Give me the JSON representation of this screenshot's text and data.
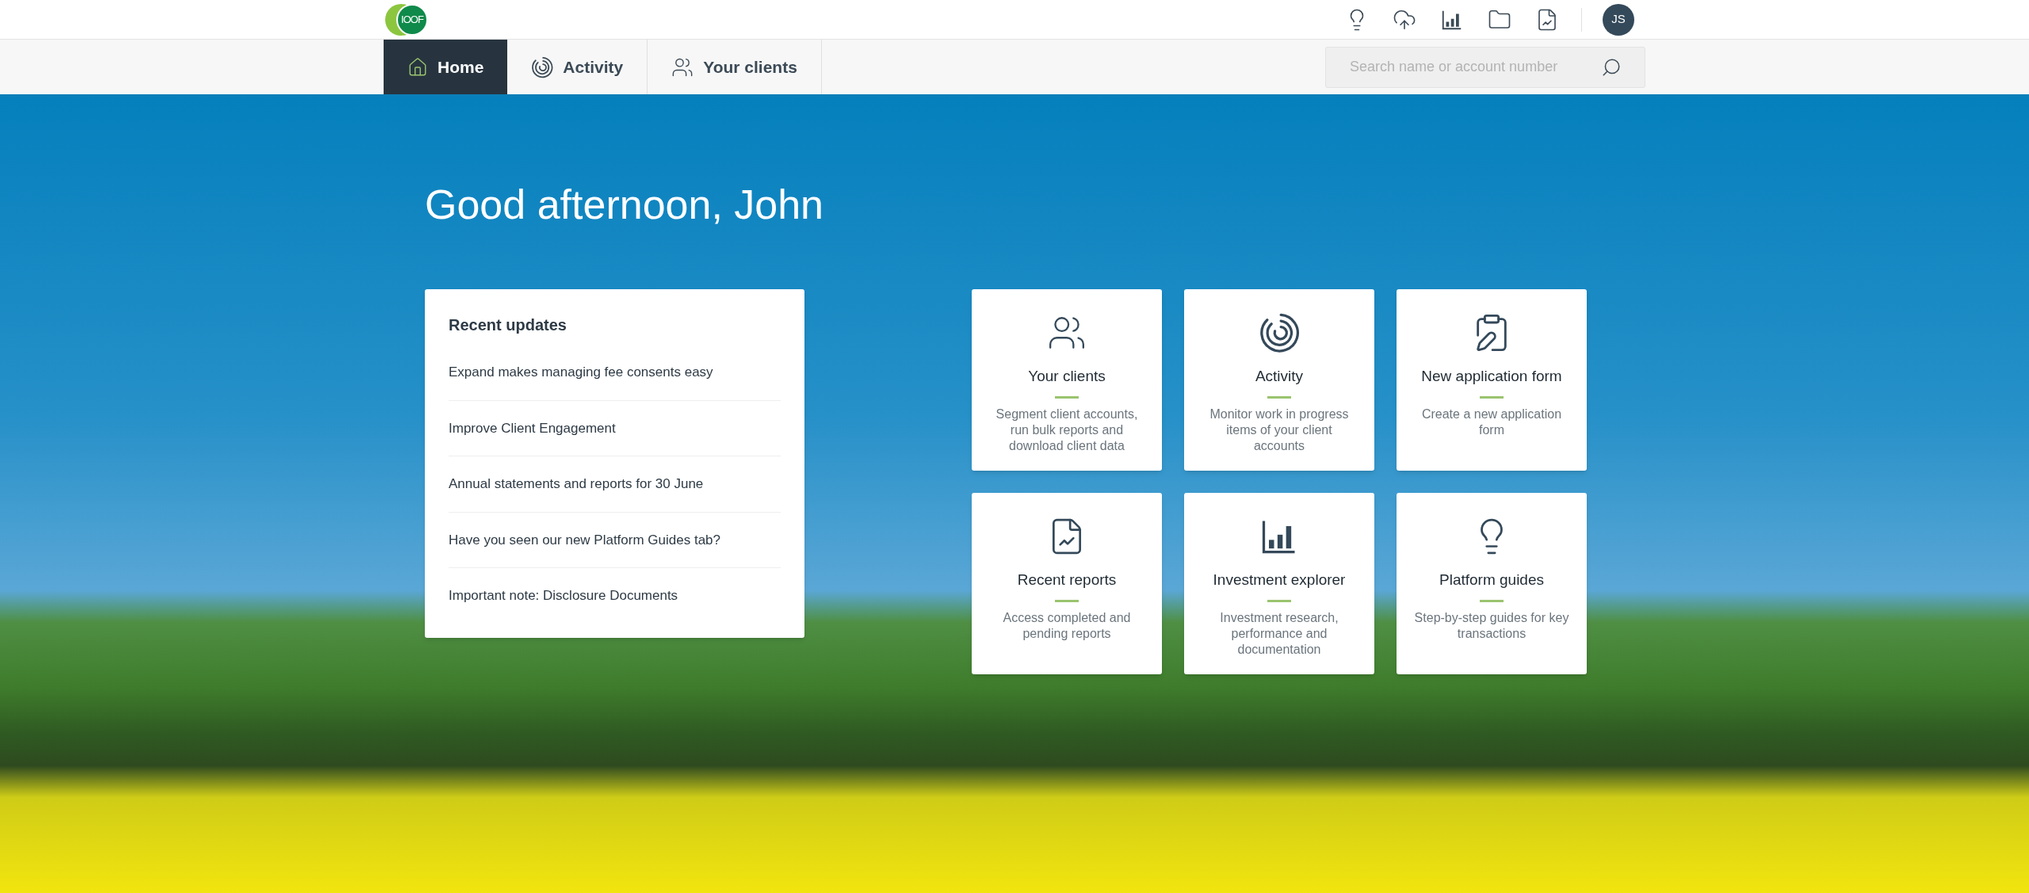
{
  "header": {
    "logo": "IOOF",
    "avatar": "JS"
  },
  "nav": {
    "tabs": [
      {
        "label": "Home",
        "selected": true
      },
      {
        "label": "Activity",
        "selected": false
      },
      {
        "label": "Your clients",
        "selected": false
      }
    ],
    "search": {
      "placeholder": "Search name or account number"
    }
  },
  "greeting": "Good afternoon, John",
  "recent_updates": {
    "title": "Recent updates",
    "items": [
      "Expand makes managing fee consents easy",
      "Improve Client Engagement",
      "Annual statements and reports for 30 June",
      "Have you seen our new Platform Guides tab?",
      "Important note: Disclosure Documents"
    ]
  },
  "tiles": [
    {
      "title": "Your clients",
      "description": "Segment client accounts, run bulk reports and download client data"
    },
    {
      "title": "Activity",
      "description": "Monitor work in progress items of your client accounts"
    },
    {
      "title": "New application form",
      "description": "Create a new application form"
    },
    {
      "title": "Recent reports",
      "description": "Access completed and pending reports"
    },
    {
      "title": "Investment explorer",
      "description": "Investment research, performance and documentation"
    },
    {
      "title": "Platform guides",
      "description": "Step-by-step guides for key transactions"
    }
  ]
}
